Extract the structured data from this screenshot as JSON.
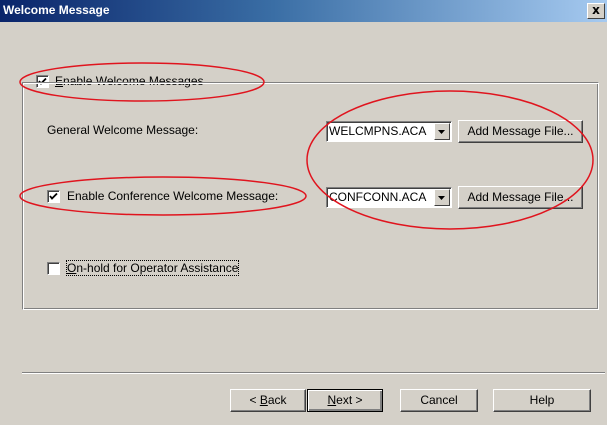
{
  "window": {
    "title": "Welcome Message",
    "close_label": "x"
  },
  "enable_welcome": {
    "label_hotkey": "E",
    "label_rest": "nable Welcome Messages",
    "checked": true
  },
  "general_welcome": {
    "label": "General Welcome Message:",
    "value": "WELCMPNS.ACA",
    "add_button": "Add Message File..."
  },
  "conference_welcome": {
    "label": "Enable Conference Welcome Message:",
    "checked": true,
    "value": "CONFCONN.ACA",
    "add_button": "Add Message File..."
  },
  "onhold": {
    "label_hotkey": "O",
    "label_rest": "n-hold for Operator Assistance",
    "checked": false
  },
  "footer": {
    "back_prefix": "< ",
    "back_hotkey": "B",
    "back_rest": "ack",
    "next_hotkey": "N",
    "next_rest": "ext >",
    "cancel": "Cancel",
    "help": "Help"
  },
  "colors": {
    "dialog_bg": "#d4d0c8",
    "title_start": "#0a246a",
    "annotation": "#e0141e"
  }
}
